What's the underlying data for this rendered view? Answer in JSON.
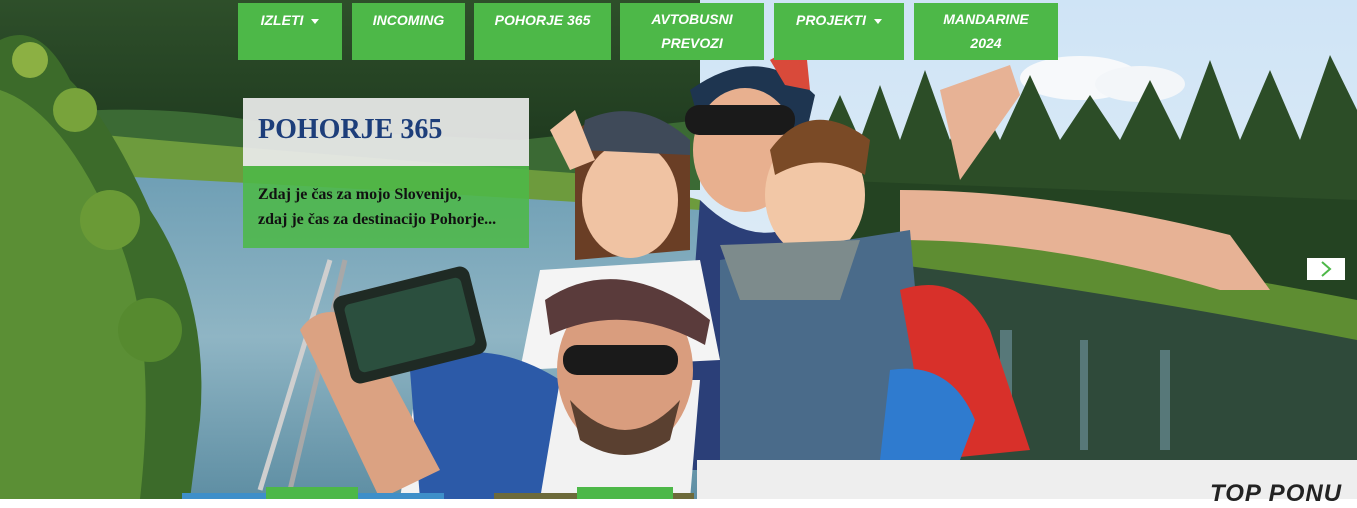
{
  "nav": {
    "items": [
      {
        "label": "IZLETI",
        "has_dropdown": true
      },
      {
        "label": "INCOMING",
        "has_dropdown": false
      },
      {
        "label": "POHORJE 365",
        "has_dropdown": false
      },
      {
        "label_line1": "AVTOBUSNI",
        "label_line2": "PREVOZI",
        "has_dropdown": false
      },
      {
        "label": "PROJEKTI",
        "has_dropdown": true
      },
      {
        "label_line1": "MANDARINE",
        "label_line2": "2024",
        "has_dropdown": false
      }
    ]
  },
  "slide": {
    "title": "POHORJE 365",
    "text_line1": "Zdaj je čas za mojo Slovenijo,",
    "text_line2": "zdaj je čas za destinacijo Pohorje..."
  },
  "slider": {
    "next_icon": "chevron-right-icon"
  },
  "section": {
    "heading": "TOP PONU"
  },
  "colors": {
    "brand_green": "#4db848",
    "title_blue": "#1d3e7a",
    "caption_box": "#ebebeb",
    "panel": "#eeeeee"
  }
}
